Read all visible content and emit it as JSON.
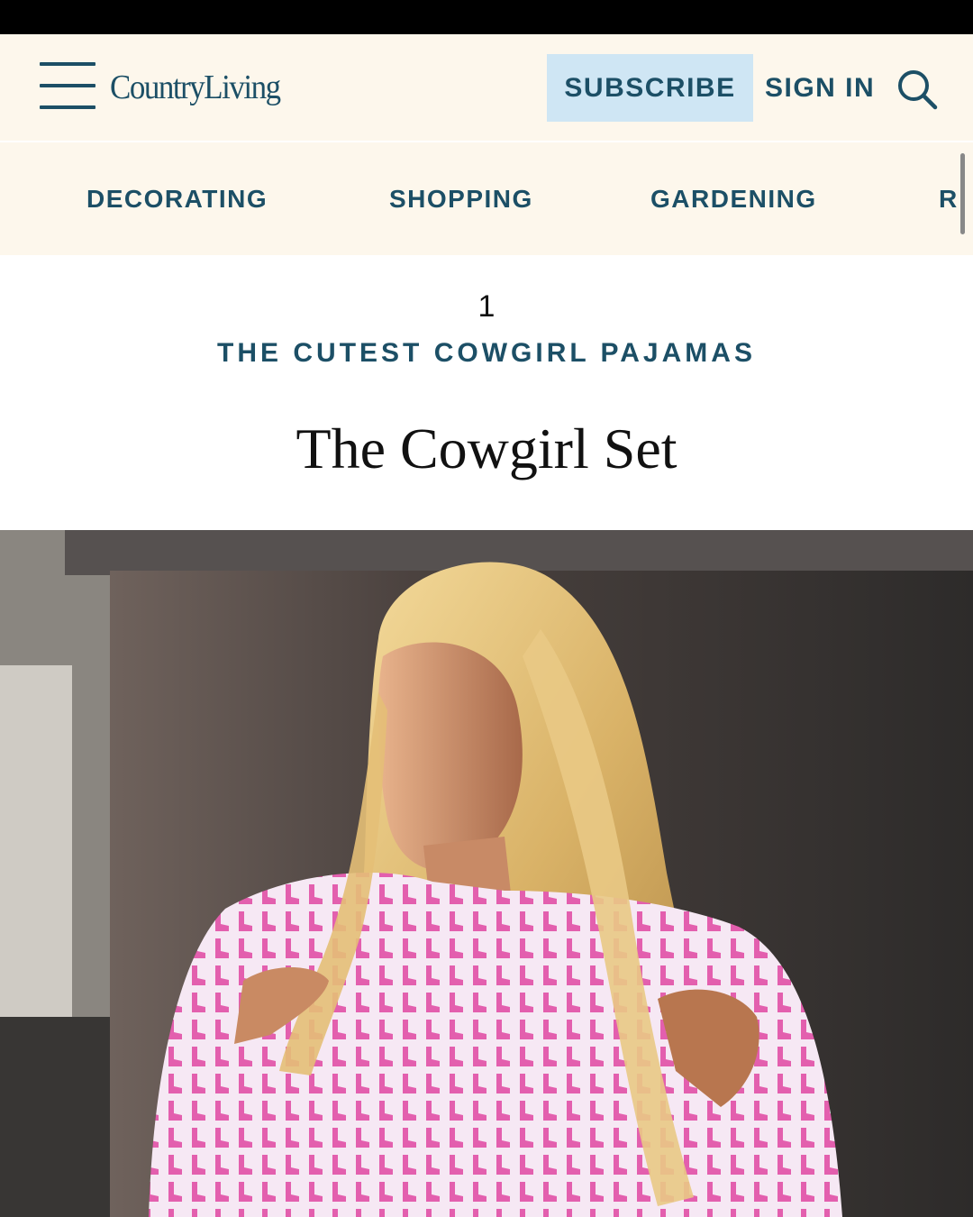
{
  "header": {
    "logo_text": "CountryLiving",
    "subscribe_label": "SUBSCRIBE",
    "signin_label": "SIGN IN",
    "menu_icon": "hamburger-menu-icon",
    "search_icon": "search-icon"
  },
  "nav": {
    "items": [
      {
        "label": "DECORATING"
      },
      {
        "label": "SHOPPING"
      },
      {
        "label": "GARDENING"
      },
      {
        "label": "R"
      }
    ]
  },
  "article": {
    "slide_number": "1",
    "kicker": "THE CUTEST COWGIRL PAJAMAS",
    "title": "The Cowgirl Set"
  },
  "colors": {
    "brand": "#1c4f66",
    "header_bg": "#fdf7ec",
    "subscribe_bg": "#cfe6f4"
  }
}
